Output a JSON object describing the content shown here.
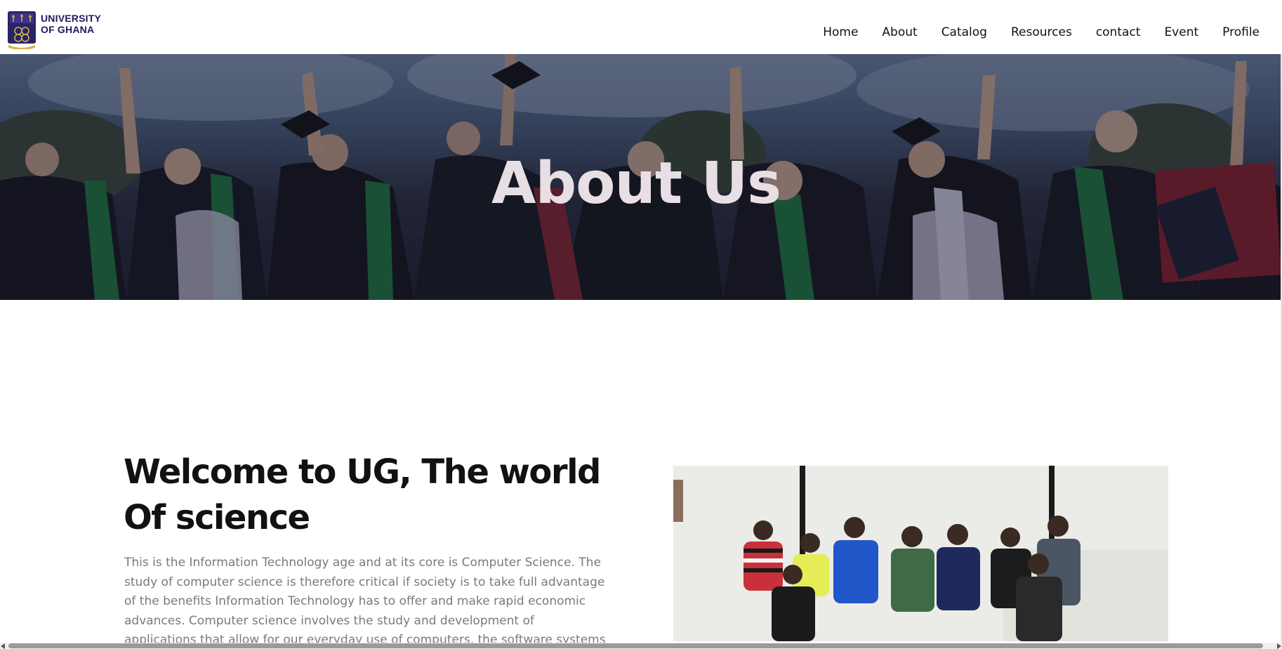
{
  "logo": {
    "line1": "UNIVERSITY",
    "line2": "OF GHANA",
    "icon": "university-crest-icon",
    "brand_color": "#1f1a5c"
  },
  "nav": {
    "items": [
      {
        "label": "Home"
      },
      {
        "label": "About"
      },
      {
        "label": "Catalog"
      },
      {
        "label": "Resources"
      },
      {
        "label": "contact"
      },
      {
        "label": "Event"
      },
      {
        "label": "Profile"
      }
    ]
  },
  "hero": {
    "title": "About Us",
    "title_color": "#e8dfe4"
  },
  "content": {
    "heading": "Welcome to UG, The world Of science",
    "body": "This is the Information Technology age and at its core is Computer Science. The study of computer science is therefore critical if society is to take full advantage of the benefits Information Technology has to offer and make rapid economic advances. Computer science involves the study and development of applications that allow for our everyday use of computers, the software systems that support these applications, and the means"
  },
  "colors": {
    "body_text": "#7a7a7a",
    "heading_text": "#111111"
  }
}
